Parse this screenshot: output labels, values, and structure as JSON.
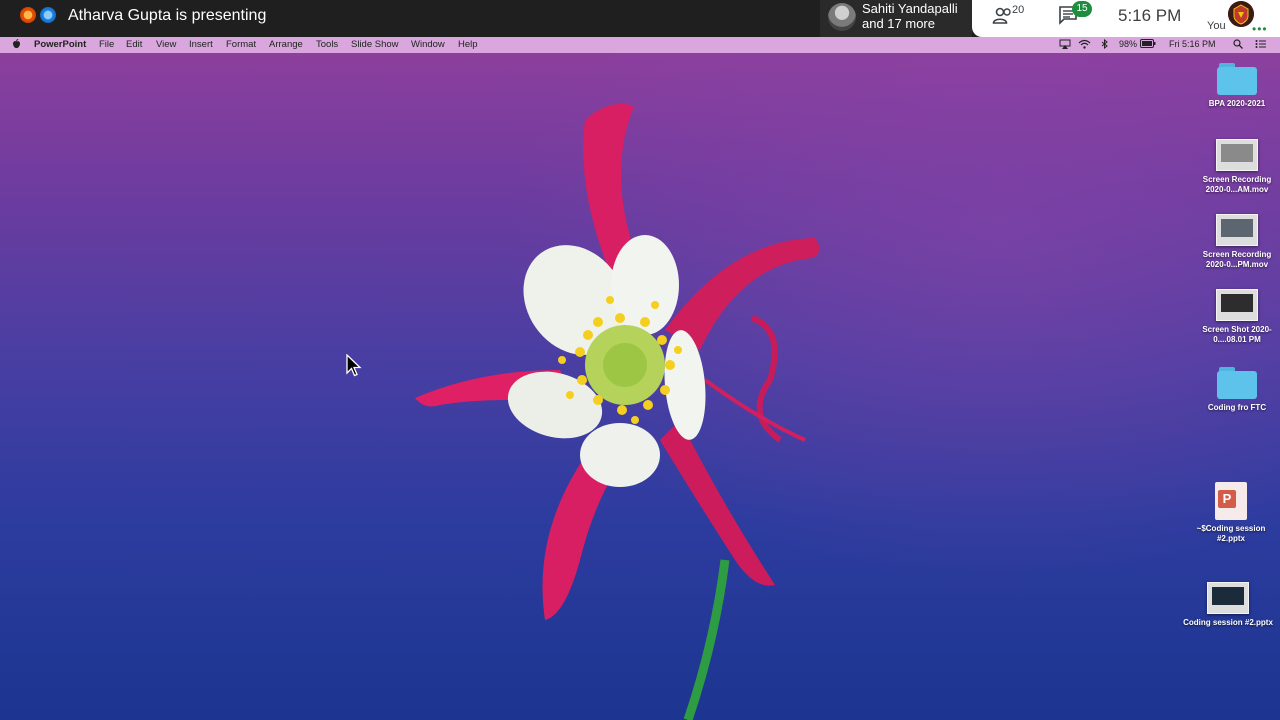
{
  "meet": {
    "presenting_text": "Atharva Gupta is presenting",
    "tile_name": "Sahiti Yandapalli",
    "tile_more": "and 17 more",
    "participants_count": "20",
    "chat_badge": "15",
    "time": "5:16 PM",
    "you_label": "You",
    "icons": [
      "meet-app-icon",
      "chrome-icon",
      "people-icon",
      "chat-icon",
      "more-options-icon"
    ]
  },
  "mac_menu": {
    "app_name": "PowerPoint",
    "items": [
      "File",
      "Edit",
      "View",
      "Insert",
      "Format",
      "Arrange",
      "Tools",
      "Slide Show",
      "Window",
      "Help"
    ],
    "battery": "98%",
    "clock": "Fri 5:16 PM"
  },
  "desktop_items": [
    {
      "label": "BPA 2020-2021",
      "type": "folder"
    },
    {
      "label": "Screen Recording 2020-0...AM.mov",
      "type": "video"
    },
    {
      "label": "Screen Recording 2020-0...PM.mov",
      "type": "video"
    },
    {
      "label": "Screen Shot 2020-0....08.01 PM",
      "type": "image"
    },
    {
      "label": "Coding fro FTC",
      "type": "folder"
    },
    {
      "label": "~$Coding session #2.pptx",
      "type": "pptx"
    },
    {
      "label": "Coding session #2.pptx",
      "type": "pptx-thumb"
    }
  ],
  "colors": {
    "meet_bar": "#1f1f1f",
    "menu_bar": "#d9a7de",
    "desktop_top": "#8c3f9d",
    "desktop_bottom": "#1c3590",
    "chat_badge": "#1e8e3e"
  }
}
